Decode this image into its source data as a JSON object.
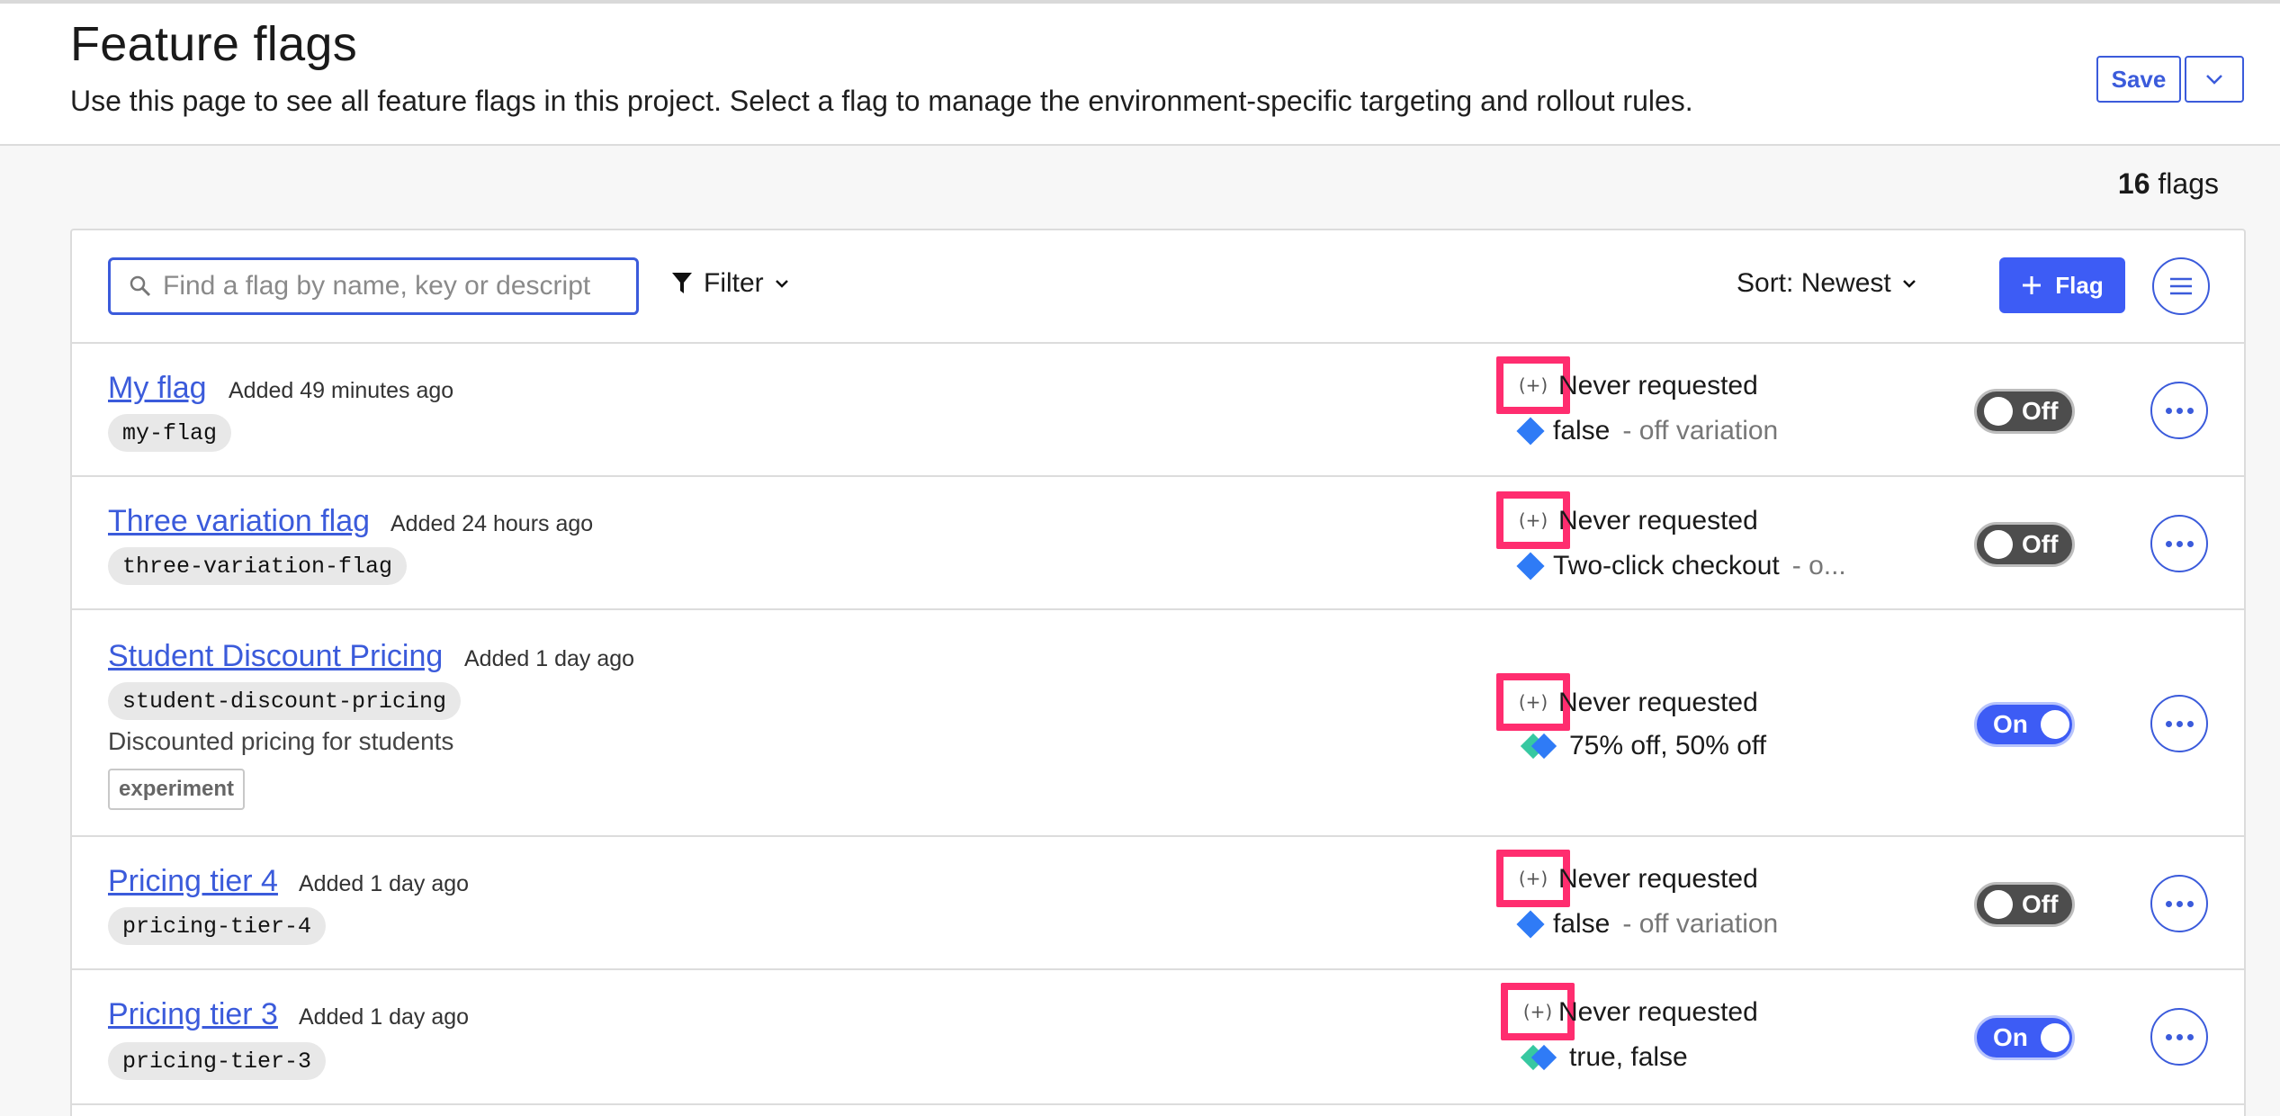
{
  "header": {
    "title": "Feature flags",
    "description": "Use this page to see all feature flags in this project. Select a flag to manage the environment-specific targeting and rollout rules.",
    "save_label": "Save"
  },
  "flag_count": {
    "number": "16",
    "label": "flags"
  },
  "toolbar": {
    "search_placeholder": "Find a flag by name, key or descript",
    "filter_label": "Filter",
    "sort_label": "Sort: Newest",
    "add_flag_label": "Flag"
  },
  "flags": [
    {
      "name": "My flag",
      "added": "Added 49 minutes ago",
      "key": "my-flag",
      "badge": "(+)",
      "status": "Never requested",
      "variation": "false",
      "variation_suffix": "- off variation",
      "toggle": "Off"
    },
    {
      "name": "Three variation flag",
      "added": "Added 24 hours ago",
      "key": "three-variation-flag",
      "badge": "(+)",
      "status": "Never requested",
      "variation": "Two-click checkout",
      "variation_suffix": "- o...",
      "toggle": "Off"
    },
    {
      "name": "Student Discount Pricing",
      "added": "Added 1 day ago",
      "key": "student-discount-pricing",
      "description": "Discounted pricing for students",
      "tag": "experiment",
      "badge": "(+)",
      "status": "Never requested",
      "variation": "75% off, 50% off",
      "toggle": "On"
    },
    {
      "name": "Pricing tier 4",
      "added": "Added 1 day ago",
      "key": "pricing-tier-4",
      "badge": "(+)",
      "status": "Never requested",
      "variation": "false",
      "variation_suffix": "- off variation",
      "toggle": "Off"
    },
    {
      "name": "Pricing tier 3",
      "added": "Added 1 day ago",
      "key": "pricing-tier-3",
      "badge": "(+)",
      "status": "Never requested",
      "variation": "true, false",
      "toggle": "On"
    }
  ],
  "colors": {
    "accent": "#3d5cf5",
    "link": "#3b5bdb",
    "highlight": "#ff2d6f",
    "toggle_off": "#4d4d4d",
    "diamond_blue": "#2f7bf6",
    "diamond_green": "#37c8a1"
  },
  "icons": [
    "search-icon",
    "filter-icon",
    "chevron-down-icon",
    "plus-icon",
    "list-menu-icon",
    "more-icon",
    "variation-diamond-icon"
  ]
}
